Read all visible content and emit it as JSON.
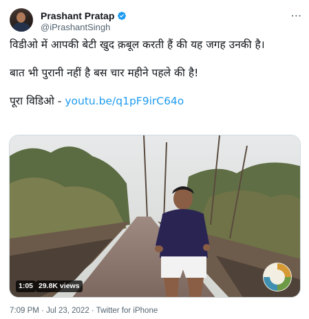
{
  "author": {
    "display_name": "Prashant Pratap",
    "handle": "@iPrashantSingh",
    "verified_icon": "verified-badge-icon"
  },
  "more_icon": "more-horizontal-icon",
  "tweet": {
    "line1": "विडीओ में आपकी बेटी खुद क़बूल करती हैं की यह जगह उनकी है।",
    "line2": "बात भी पुरानी नहीं है बस चार महीने पहले की है!",
    "line3_prefix": "पूरा विडिओ - ",
    "link_text": "youtu.be/q1pF9irC64o"
  },
  "video": {
    "duration": "1:05",
    "views": "29.8K views"
  },
  "meta": {
    "time": "7:09 PM",
    "separator1": " · ",
    "date": "Jul 23, 2022",
    "separator2": " · ",
    "source": "Twitter for iPhone"
  },
  "colors": {
    "link": "#1d9bf0",
    "verified": "#1d9bf0",
    "secondary_text": "#536471"
  }
}
